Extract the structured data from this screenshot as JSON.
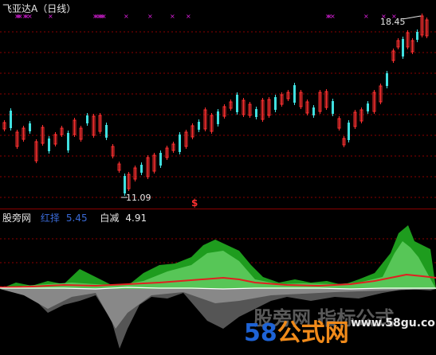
{
  "header": {
    "stock_title": "飞亚达A（日线）"
  },
  "price_chart": {
    "high_label": "18.45",
    "low_label": "11.09",
    "signal_mark": "$",
    "colors": {
      "up": "#ff3030",
      "down": "#40e0e0",
      "marker": "#e020e0",
      "grid": "#8b0000"
    }
  },
  "indicator": {
    "name": "股旁网",
    "hong_label": "红择",
    "hong_value": "5.45",
    "bai_label": "白减",
    "bai_value": "4.91",
    "colors": {
      "green": "#1e9c1e",
      "light_green": "#57c657",
      "red_line": "#e02020",
      "white_line": "#ffffff",
      "gray": "#555555"
    }
  },
  "watermark": {
    "cn_text": "股旁网 指标公式",
    "logo_num": "58",
    "logo_text": "公式网",
    "url": "www.58gu.com"
  }
}
